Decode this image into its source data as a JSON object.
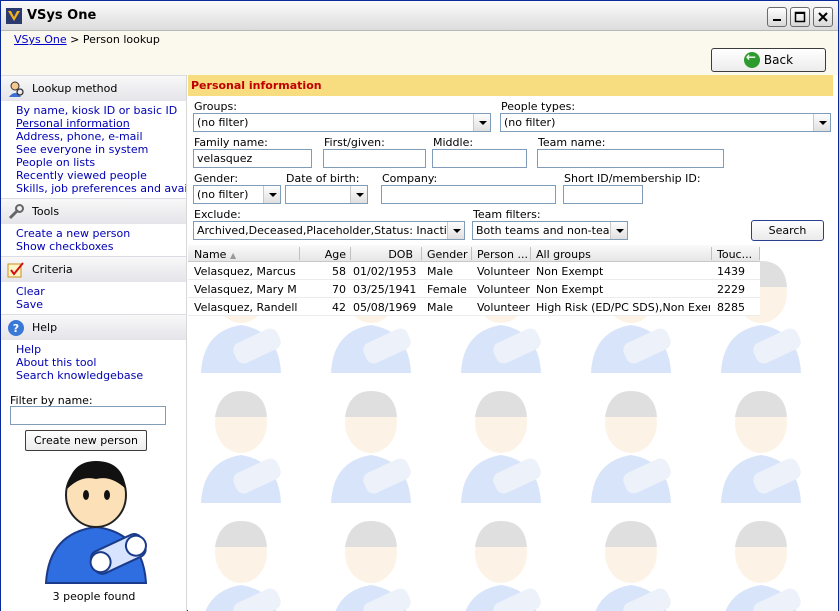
{
  "window": {
    "title": "VSys One"
  },
  "breadcrumb": {
    "root": "VSys One",
    "separator": ">",
    "current": "Person lookup"
  },
  "back_label": "Back",
  "left": {
    "lookup": {
      "title": "Lookup method",
      "items": [
        "By name, kiosk ID or basic ID",
        "Personal information",
        "Address, phone, e-mail",
        "See everyone in system",
        "People on lists",
        "Recently viewed people",
        "Skills, job preferences and availa..."
      ]
    },
    "tools": {
      "title": "Tools",
      "items": [
        "Create a new person",
        "Show checkboxes"
      ]
    },
    "criteria": {
      "title": "Criteria",
      "items": [
        "Clear",
        "Save"
      ]
    },
    "help": {
      "title": "Help",
      "items": [
        "Help",
        "About this tool",
        "Search knowledgebase"
      ]
    },
    "filter_label": "Filter by name:",
    "create_button": "Create new person",
    "people_found": "3 people found"
  },
  "form": {
    "section_title": "Personal information",
    "groups": {
      "label": "Groups:",
      "value": "(no filter)"
    },
    "people_types": {
      "label": "People types:",
      "value": "(no filter)"
    },
    "family_name": {
      "label": "Family name:",
      "value": "velasquez"
    },
    "first_name": {
      "label": "First/given:",
      "value": ""
    },
    "middle": {
      "label": "Middle:",
      "value": ""
    },
    "team_name": {
      "label": "Team name:",
      "value": ""
    },
    "gender": {
      "label": "Gender:",
      "value": "(no filter)"
    },
    "dob": {
      "label": "Date of birth:",
      "value": ""
    },
    "company": {
      "label": "Company:",
      "value": ""
    },
    "short_id": {
      "label": "Short ID/membership ID:",
      "value": ""
    },
    "exclude": {
      "label": "Exclude:",
      "value": "Archived,Deceased,Placeholder,Status: Inactive,Sta"
    },
    "team_filters": {
      "label": "Team filters:",
      "value": "Both teams and non-teams"
    },
    "search_button": "Search"
  },
  "grid": {
    "columns": [
      "Name",
      "Age",
      "DOB",
      "Gender",
      "Person ...",
      "All groups",
      "Touc..."
    ],
    "rows": [
      [
        "Velasquez, Marcus D",
        "58",
        "01/02/1953",
        "Male",
        "Volunteer",
        "Non Exempt",
        "1439"
      ],
      [
        "Velasquez, Mary M",
        "70",
        "03/25/1941",
        "Female",
        "Volunteer",
        "Non Exempt",
        "2229"
      ],
      [
        "Velasquez, Randell M",
        "42",
        "05/08/1969",
        "Male",
        "Volunteer",
        "High Risk (ED/PC SDS),Non Exempt",
        "8285"
      ]
    ]
  },
  "colors": {
    "title_bar": "#dcdcdc",
    "section_bar": "#f8dc80",
    "section_title": "#c00000",
    "link": "#0000b4"
  }
}
